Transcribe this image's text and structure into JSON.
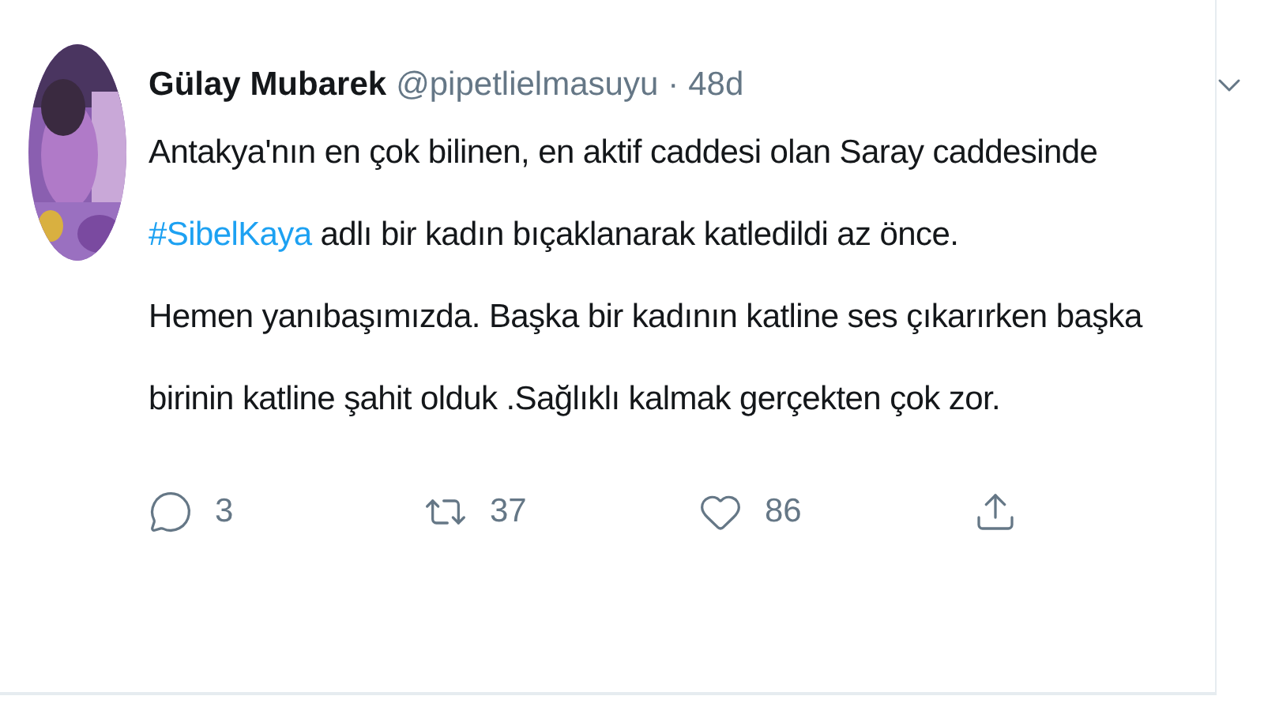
{
  "tweet": {
    "author": {
      "name": "Gülay Mubarek",
      "handle": "@pipetlielmasuyu",
      "separator": "·",
      "age": "48d"
    },
    "lines": [
      {
        "text": "Antakya'nın en çok bilinen, en aktif caddesi olan Saray caddesinde"
      },
      {
        "hashtag": "#SibelKaya",
        "text": "adlı bir kadın bıçaklanarak katledildi az önce."
      },
      {
        "text": "Hemen yanıbaşımızda. Başka bir kadının katline ses çıkarırken başka"
      },
      {
        "text": "birinin katline şahit olduk .Sağlıklı kalmak gerçekten çok zor."
      }
    ],
    "actions": [
      {
        "kind": "reply",
        "count": "3"
      },
      {
        "kind": "retweet",
        "count": "37"
      },
      {
        "kind": "like",
        "count": "86"
      },
      {
        "kind": "share"
      }
    ]
  }
}
